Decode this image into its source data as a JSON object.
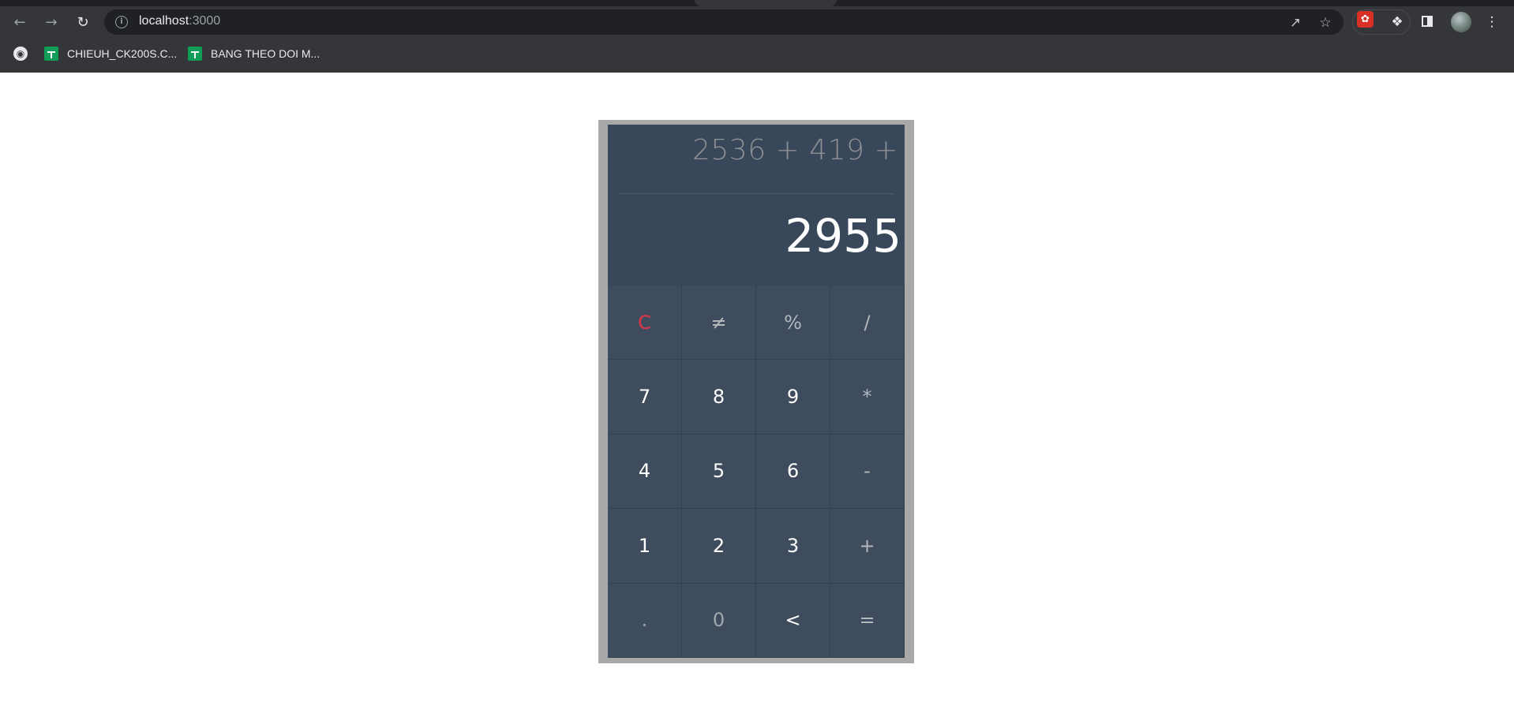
{
  "browser": {
    "url_host": "localhost",
    "url_port": ":3000",
    "bookmarks": [
      {
        "label": "CHIEUH_CK200S.C...",
        "icon": "google-sheets-icon"
      },
      {
        "label": "BANG THEO DOI M...",
        "icon": "google-sheets-icon"
      }
    ]
  },
  "calculator": {
    "expression": "2536 + 419 +",
    "result": "2955",
    "keys": [
      {
        "label": "C",
        "role": "clear"
      },
      {
        "label": "≠",
        "role": "op"
      },
      {
        "label": "%",
        "role": "op"
      },
      {
        "label": "/",
        "role": "op"
      },
      {
        "label": "7",
        "role": "digit"
      },
      {
        "label": "8",
        "role": "digit"
      },
      {
        "label": "9",
        "role": "digit"
      },
      {
        "label": "*",
        "role": "op"
      },
      {
        "label": "4",
        "role": "digit"
      },
      {
        "label": "5",
        "role": "digit"
      },
      {
        "label": "6",
        "role": "digit"
      },
      {
        "label": "-",
        "role": "op"
      },
      {
        "label": "1",
        "role": "digit"
      },
      {
        "label": "2",
        "role": "digit"
      },
      {
        "label": "3",
        "role": "digit"
      },
      {
        "label": "+",
        "role": "op"
      },
      {
        "label": ".",
        "role": "dim"
      },
      {
        "label": "0",
        "role": "dim"
      },
      {
        "label": "<",
        "role": "digit"
      },
      {
        "label": "=",
        "role": "op"
      }
    ],
    "colors": {
      "clear": "#e0344a",
      "display_bg": "#38475a",
      "key_bg": "#3e4c5e",
      "frame": "#a9a9a9"
    }
  }
}
